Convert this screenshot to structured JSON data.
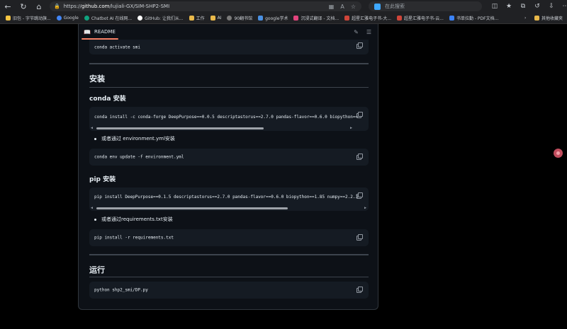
{
  "browser": {
    "url_prefix": "https://",
    "url_host": "github.com",
    "url_path": "/lujiali-GX/SIM-SHP2-SMI",
    "search_placeholder": "在此搜索"
  },
  "bookmarks": [
    {
      "label": "旧包 - 字节跳动旗...",
      "color": "#f5c542"
    },
    {
      "label": "Google",
      "color": "#4285f4"
    },
    {
      "label": "Chatbot AI 在线网...",
      "color": "#10a37f"
    },
    {
      "label": "GitHub: 让我们从...",
      "color": "#ffffff"
    },
    {
      "label": "工作",
      "color": "#e8b84a"
    },
    {
      "label": "AI",
      "color": "#e8b84a"
    },
    {
      "label": "90翻书馆",
      "color": "#7a7a7a"
    },
    {
      "label": "google学术",
      "color": "#4a90e2"
    },
    {
      "label": "沉浸式翻译 - 文档...",
      "color": "#e2447d"
    },
    {
      "label": "超星汇雅电子书-大...",
      "color": "#d0453a"
    },
    {
      "label": "超星汇雅电子书-云...",
      "color": "#d0453a"
    },
    {
      "label": "书单拉勤 - PDF文档...",
      "color": "#3b82f6"
    }
  ],
  "bookmarks_other": "其他收藏夹",
  "readme": {
    "tab_label": "README",
    "top_code": "conda activate smi",
    "section_install": "安装",
    "conda_heading": "conda 安装",
    "conda_code": "conda install -c conda-forge DeepPurpose==0.0.5 descriptastorus==2.7.0 pandas-flavor==0.6.0 biopython==",
    "conda_alt": "或者通过 environment.yml安装",
    "conda_env_code": "conda env update -f environment.yml",
    "pip_heading": "pip 安装",
    "pip_code": "pip install DeepPurpose==0.1.5 descriptastorus==2.7.0 pandas-flavor==0.6.0 biopython==1.85 numpy==2.2.3",
    "pip_alt": "或者通过requirements.txt安装",
    "pip_req_code": "pip install -r requirements.txt",
    "section_run": "运行",
    "run_code": "python shp2_smi/DP.py"
  }
}
